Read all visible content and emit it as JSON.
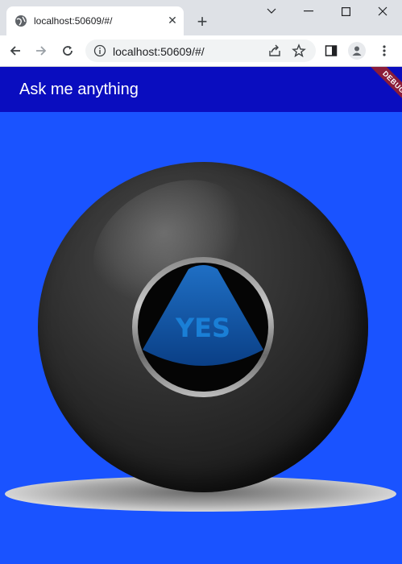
{
  "browser": {
    "tab": {
      "title": "localhost:50609/#/",
      "icon": "globe-icon"
    },
    "new_tab_icon": "plus-icon",
    "window_controls": [
      "chevron-down-icon",
      "minimize-icon",
      "maximize-icon",
      "close-icon"
    ],
    "address": {
      "url": "localhost:50609/#/"
    },
    "toolbar_icons": [
      "back-arrow-icon",
      "forward-arrow-icon",
      "reload-icon",
      "info-icon",
      "share-icon",
      "star-icon",
      "sidepanel-icon",
      "profile-icon",
      "menu-dots-icon"
    ]
  },
  "app": {
    "title": "Ask me anything",
    "debug_label": "DEBUG",
    "answer": "YES",
    "colors": {
      "appbar": "#0a0dbf",
      "background": "#1a53ff",
      "answer": "#1a7fd6",
      "debug_banner": "#8b1d3a"
    }
  }
}
